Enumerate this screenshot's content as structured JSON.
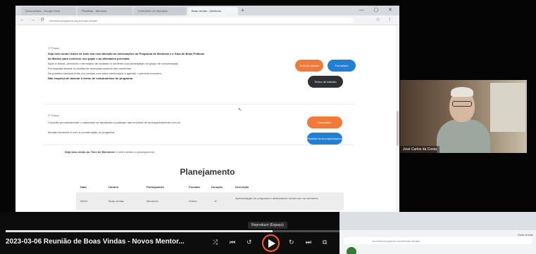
{
  "browser": {
    "tabs": [
      {
        "label": "Documentos - Google Drive"
      },
      {
        "label": "Planilhas - Mentoria"
      },
      {
        "label": "Formulário de Inscrição"
      },
      {
        "label": "Boas vindas - Mentores"
      }
    ],
    "active_tab_index": 3,
    "new_tab_glyph": "+",
    "window_controls": "—  ▢  ✕",
    "nav_glyphs": "←  →  ⟳",
    "url": "mentoria.programa.org.br/boas-vindas",
    "address_tools": "☆  ⋮"
  },
  "page": {
    "section1": {
      "title": "1º Passo",
      "lines": [
        "Seja bem-vindo! Antes de tudo leia com atenção as informações do Programa de Mentoria e o Guia de Boas Práticas",
        "do Mentor para conhecer seu papel e as atividades previstas.",
        "Após a leitura, preencha o formulário de cadastro e confirme sua participação no grupo de comunicação.",
        "Em seguida acesse a planilha de acompanhamento das mentorias.",
        "Na primeira semana entre em contato com seus mentorados e agende o primeiro encontro.",
        "Não esqueça de assinar o termo de compromisso do programa."
      ],
      "bold_flags": [
        true,
        true,
        false,
        false,
        false,
        true
      ],
      "buttons": [
        {
          "label": "Guia do Mentor",
          "color": "orange"
        },
        {
          "label": "Formulário",
          "color": "blue"
        },
        {
          "label": "Termo de Adesão",
          "color": "dark"
        }
      ]
    },
    "section2": {
      "title": "2º Passo",
      "lines": [
        "Consulte periodicamente o calendário de atividades e participe das reuniões de acompanhamento com os",
        "demais mentores e com a coordenação do programa."
      ],
      "buttons": [
        {
          "label": "Calendário",
          "color": "orange"
        },
        {
          "label": "Planilha de Acompanhamento",
          "color": "blue"
        }
      ]
    },
    "subline_bold": "Seja bem-vindo ao Time de Mentores!",
    "subline_rest": "Confira abaixo o planejamento.",
    "planning_title": "Planejamento",
    "table": {
      "headers": [
        "Data",
        "Horário",
        "Participantes",
        "Formato",
        "Duração",
        "Descrição"
      ],
      "row1": [
        "06/03",
        "Boas-vindas",
        "Mentores",
        "Online",
        "1h",
        "Apresentação do programa e alinhamento inicial com os mentores"
      ]
    }
  },
  "participant": {
    "name": "José Carlos da Costa"
  },
  "preview": {
    "url": "mentoria.programa.org.br/boas-vindas",
    "tab_label": "Boas vindas"
  },
  "player": {
    "title": "2023-03-06 Reunião de Boas Vindas - Novos Mentor...",
    "tooltip": "Reproduzir (Espaço)",
    "progress": 0.8,
    "controls": {
      "shuffle": "⤮",
      "previous": "⏮",
      "rewind": "↺",
      "forward": "↻",
      "next": "⏭",
      "cast": "⧉"
    },
    "accent_color": "#ff5a1f"
  }
}
